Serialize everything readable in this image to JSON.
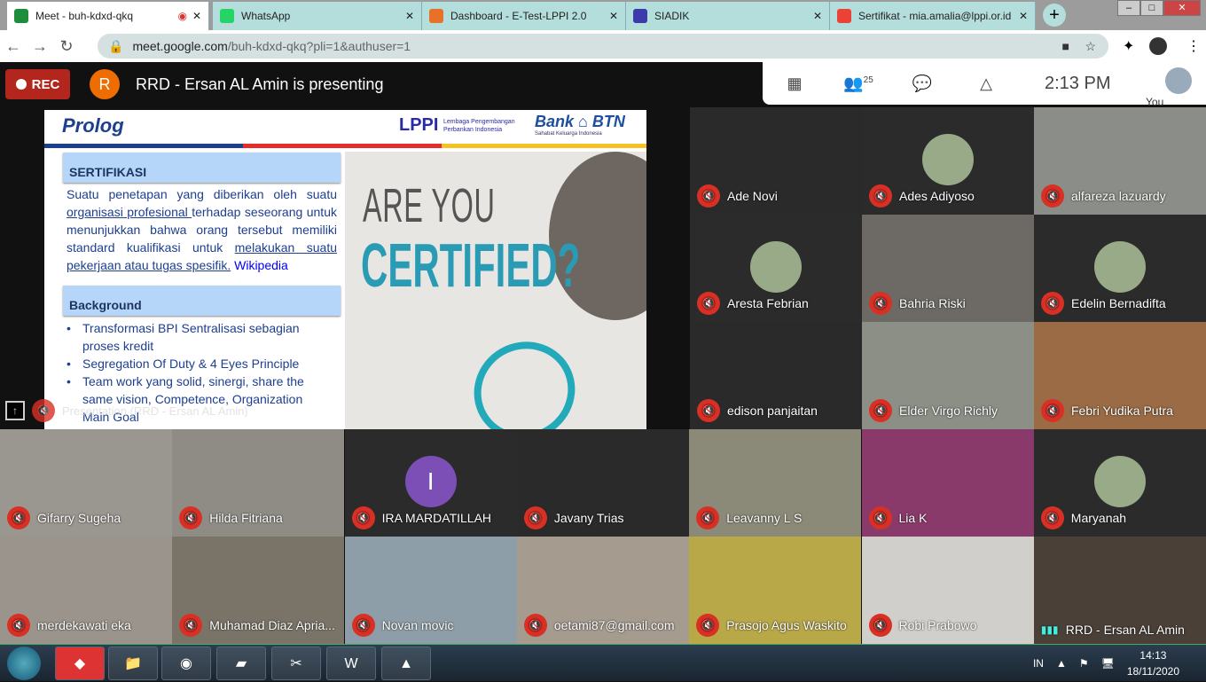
{
  "tabs": [
    {
      "label": "Meet - buh-kdxd-qkq",
      "color": "#1e8e3e",
      "active": true
    },
    {
      "label": "WhatsApp",
      "color": "#25d366"
    },
    {
      "label": "Dashboard - E-Test-LPPI 2.0",
      "color": "#e8712a"
    },
    {
      "label": "SIADIK",
      "color": "#3a3aaa"
    },
    {
      "label": "Sertifikat - mia.amalia@lppi.or.id",
      "color": "#ea4335"
    }
  ],
  "address": {
    "host": "meet.google.com",
    "path": "/buh-kdxd-qkq?pli=1&authuser=1"
  },
  "meet": {
    "rec_label": "REC",
    "presenter_initial": "R",
    "presenting_text": "RRD - Ersan AL Amin is presenting",
    "people_count": "25",
    "time": "2:13 PM",
    "you_label": "You",
    "presentation_label": "Presentation (RRD - Ersan AL Amin)"
  },
  "slide": {
    "title": "Prolog",
    "lppi_logo": "LPPI",
    "lppi_text": "Lembaga Pengembangan Perbankan Indonesia",
    "btn_logo": "Bank BTN",
    "btn_tagline": "Sahabat Keluarga Indonesia",
    "section1": "SERTIFIKASI",
    "para_a": "Suatu penetapan yang diberikan oleh suatu ",
    "para_link1": "organisasi profesional ",
    "para_b": "terhadap seseorang untuk menunjukkan bahwa orang tersebut memiliki standard kualifikasi untuk ",
    "para_link2": "melakukan suatu pekerjaan atau tugas spesifik.",
    "para_wiki": "Wikipedia",
    "section2": "Background",
    "bullets": [
      "Transformasi BPI Sentralisasi sebagian proses kredit",
      "Segregation Of Duty & 4 Eyes Principle",
      "Team work yang solid, sinergi, share the same vision, Competence, Organization Main Goal"
    ],
    "image_line1": "ARE YOU",
    "image_line2": "CERTIFIED?"
  },
  "participants": [
    {
      "name": "Ade Novi",
      "bg": "#2a2a2a"
    },
    {
      "name": "Ades Adiyoso",
      "bg": "#2b2b2b",
      "avatar": "photo"
    },
    {
      "name": "alfareza lazuardy",
      "bg": "#8a8d88"
    },
    {
      "name": "Aresta Febrian",
      "bg": "#2b2b2b",
      "avatar": "photo"
    },
    {
      "name": "Bahria Riski",
      "bg": "#6d6a66"
    },
    {
      "name": "Edelin Bernadifta",
      "bg": "#2b2b2b",
      "avatar": "photo"
    },
    {
      "name": "edison panjaitan",
      "bg": "#2a2a2a"
    },
    {
      "name": "Elder Virgo Richly",
      "bg": "#8c8f86"
    },
    {
      "name": "Febri Yudika Putra",
      "bg": "#9a6b45"
    },
    {
      "name": "Gifarry Sugeha",
      "bg": "#9a9690"
    },
    {
      "name": "Hilda Fitriana",
      "bg": "#8f8c86"
    },
    {
      "name": "IRA MARDATILLAH",
      "bg": "#2b2b2b",
      "avatar": "I"
    },
    {
      "name": "Javany Trias",
      "bg": "#2a2a2a"
    },
    {
      "name": "Leavanny L S",
      "bg": "#8b8a78"
    },
    {
      "name": "Lia K",
      "bg": "#8a3a6a"
    },
    {
      "name": "Maryanah",
      "bg": "#2b2b2b",
      "avatar": "photo"
    },
    {
      "name": "merdekawati eka",
      "bg": "#9a948c"
    },
    {
      "name": "Muhamad Diaz Apria...",
      "bg": "#7a7468"
    },
    {
      "name": "Novan movic",
      "bg": "#8e9ea8"
    },
    {
      "name": "oetami87@gmail.com",
      "bg": "#a59b8e"
    },
    {
      "name": "Prasojo Agus Waskito",
      "bg": "#b8a848"
    },
    {
      "name": "Robi Prabowo",
      "bg": "#d0cfcb"
    },
    {
      "name": "RRD - Ersan AL Amin",
      "bg": "#4a4038",
      "speaking": true
    }
  ],
  "taskbar": {
    "lang": "IN",
    "time": "14:13",
    "date": "18/11/2020"
  }
}
